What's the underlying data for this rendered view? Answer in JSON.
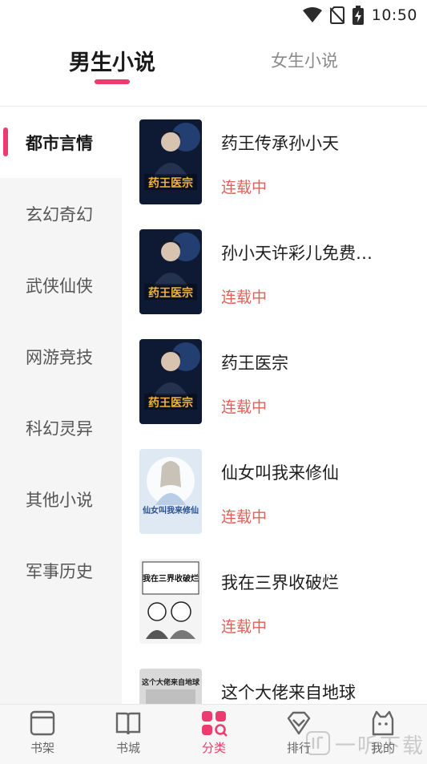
{
  "status_bar": {
    "time": "10:50",
    "icons": [
      "wifi-icon",
      "no-sim-icon",
      "battery-charging-icon"
    ]
  },
  "gender_tabs": [
    {
      "label": "男生小说",
      "active": true
    },
    {
      "label": "女生小说",
      "active": false
    }
  ],
  "categories": [
    {
      "label": "都市言情",
      "active": true
    },
    {
      "label": "玄幻奇幻",
      "active": false
    },
    {
      "label": "武侠仙侠",
      "active": false
    },
    {
      "label": "网游竞技",
      "active": false
    },
    {
      "label": "科幻灵异",
      "active": false
    },
    {
      "label": "其他小说",
      "active": false
    },
    {
      "label": "军事历史",
      "active": false
    }
  ],
  "books": [
    {
      "title": "药王传承孙小天",
      "status": "连载中",
      "cover_text": "药王医宗"
    },
    {
      "title": "孙小天许彩儿免费…",
      "status": "连载中",
      "cover_text": "药王医宗"
    },
    {
      "title": "药王医宗",
      "status": "连载中",
      "cover_text": "药王医宗"
    },
    {
      "title": "仙女叫我来修仙",
      "status": "连载中",
      "cover_text": "仙女叫我来修仙"
    },
    {
      "title": "我在三界收破烂",
      "status": "连载中",
      "cover_text": "我在三界收破烂"
    },
    {
      "title": "这个大佬来自地球",
      "status": "",
      "cover_text": "这个大佬来自地球"
    }
  ],
  "bottom_nav": [
    {
      "label": "书架",
      "icon": "bookshelf-icon",
      "active": false
    },
    {
      "label": "书城",
      "icon": "book-city-icon",
      "active": false
    },
    {
      "label": "分类",
      "icon": "category-icon",
      "active": true
    },
    {
      "label": "排行",
      "icon": "ranking-icon",
      "active": false
    },
    {
      "label": "我的",
      "icon": "profile-icon",
      "active": false
    }
  ],
  "watermark": {
    "text": "一听下载"
  },
  "colors": {
    "accent": "#ec3b6e",
    "status_serial": "#e0605a",
    "sidebar_bg": "#f5f5f5"
  }
}
